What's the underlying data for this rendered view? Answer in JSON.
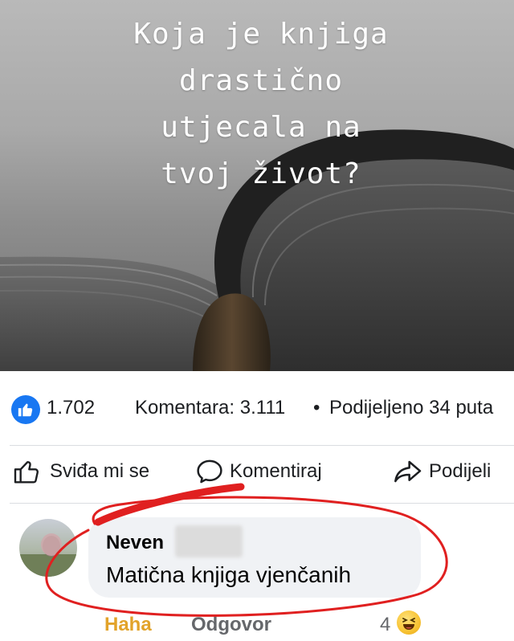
{
  "post": {
    "image_text_lines": [
      "Koja je knjiga",
      "drastično",
      "utjecala na",
      "tvoj život?"
    ]
  },
  "stats": {
    "likes": "1.702",
    "comments": "Komentara: 3.111",
    "separator": "•",
    "shares": "Podijeljeno 34 puta"
  },
  "actions": {
    "like": "Sviđa mi se",
    "comment": "Komentiraj",
    "share": "Podijeli"
  },
  "comment": {
    "author": "Neven",
    "text": "Matična knjiga vjenčanih",
    "haha_label": "Haha",
    "reply_label": "Odgovor",
    "reaction_count": "4"
  },
  "colors": {
    "facebook_blue": "#1877f2",
    "bubble_bg": "#f0f2f5",
    "haha_orange": "#e2a32a",
    "annotation_red": "#e02020"
  },
  "icons": {
    "like_badge": "thumbs-up-icon",
    "like_action": "thumbs-up-outline-icon",
    "comment_action": "speech-bubble-icon",
    "share_action": "share-arrow-icon",
    "reaction": "haha-emoji-icon"
  }
}
